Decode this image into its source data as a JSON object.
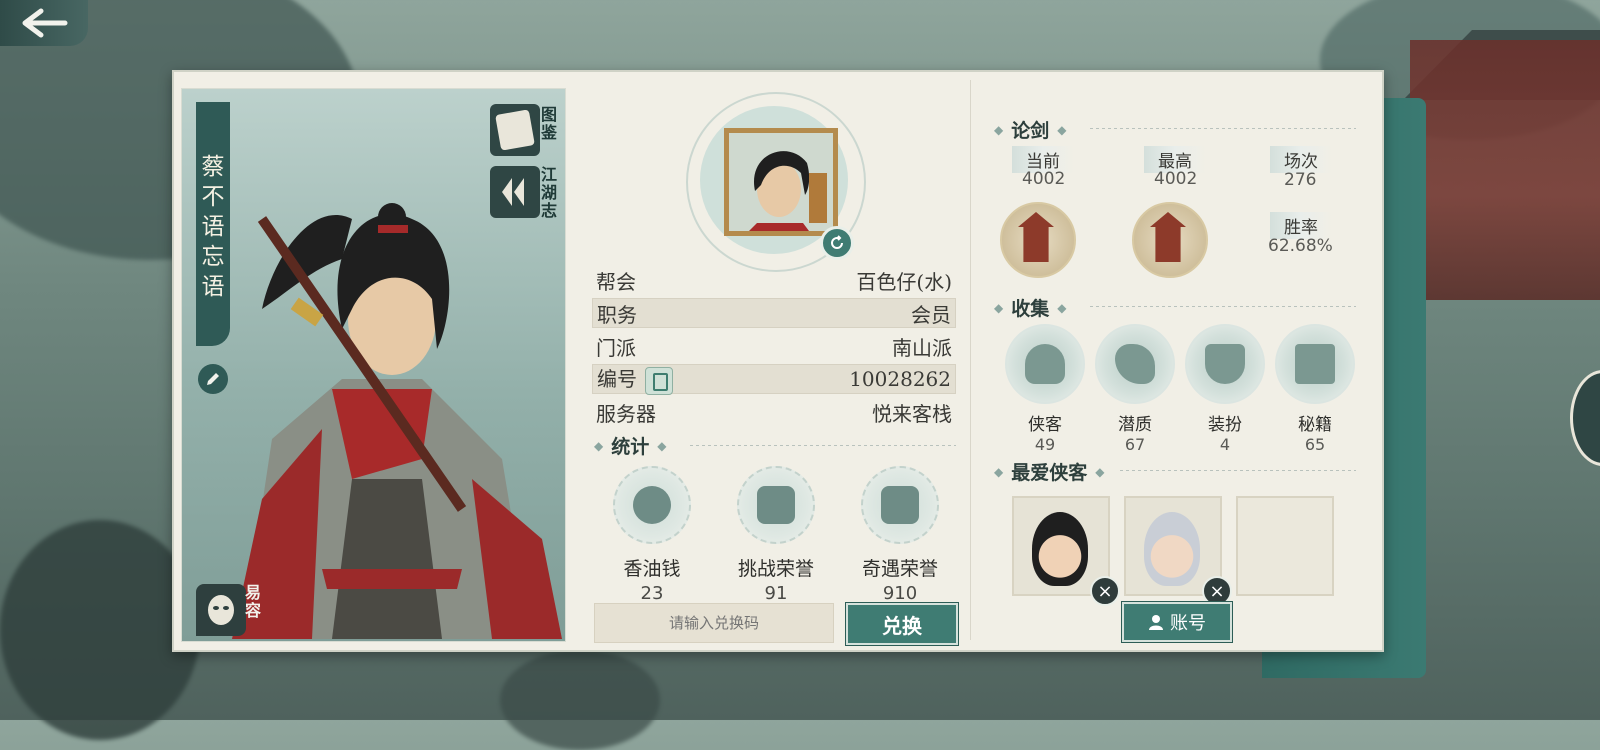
{
  "profile": {
    "name_chars": [
      "蔡",
      "不",
      "语",
      "忘",
      "语"
    ]
  },
  "left_buttons": {
    "atlas": [
      "图",
      "鉴"
    ],
    "chronicle": [
      "江",
      "湖",
      "志"
    ],
    "disguise": [
      "易",
      "容"
    ]
  },
  "info": {
    "guild_label": "帮会",
    "guild_value": "百色仔(水)",
    "role_label": "职务",
    "role_value": "会员",
    "sect_label": "门派",
    "sect_value": "南山派",
    "id_label": "编号",
    "id_value": "10028262",
    "server_label": "服务器",
    "server_value": "悦来客栈"
  },
  "stats": {
    "title": "统计",
    "items": [
      {
        "label": "香油钱",
        "value": "23",
        "icon": "coins-icon"
      },
      {
        "label": "挑战荣誉",
        "value": "91",
        "icon": "challenge-honor-icon"
      },
      {
        "label": "奇遇荣誉",
        "value": "910",
        "icon": "encounter-honor-icon"
      }
    ]
  },
  "redeem": {
    "placeholder": "请输入兑换码",
    "button_label": "兑换"
  },
  "arena": {
    "title": "论剑",
    "current_label": "当前",
    "current_value": "4002",
    "highest_label": "最高",
    "highest_value": "4002",
    "matches_label": "场次",
    "matches_value": "276",
    "winrate_label": "胜率",
    "winrate_value": "62.68%"
  },
  "collection": {
    "title": "收集",
    "items": [
      {
        "label": "侠客",
        "value": "49",
        "icon": "hero-icon"
      },
      {
        "label": "潜质",
        "value": "67",
        "icon": "dragon-potential-icon"
      },
      {
        "label": "装扮",
        "value": "4",
        "icon": "outfit-icon"
      },
      {
        "label": "秘籍",
        "value": "65",
        "icon": "manual-icon"
      }
    ]
  },
  "favorites": {
    "title": "最爱侠客",
    "account_label": "账号"
  },
  "colors": {
    "accent": "#3f7c73",
    "panel": "#f1efe6",
    "dark": "#2f5a56"
  }
}
